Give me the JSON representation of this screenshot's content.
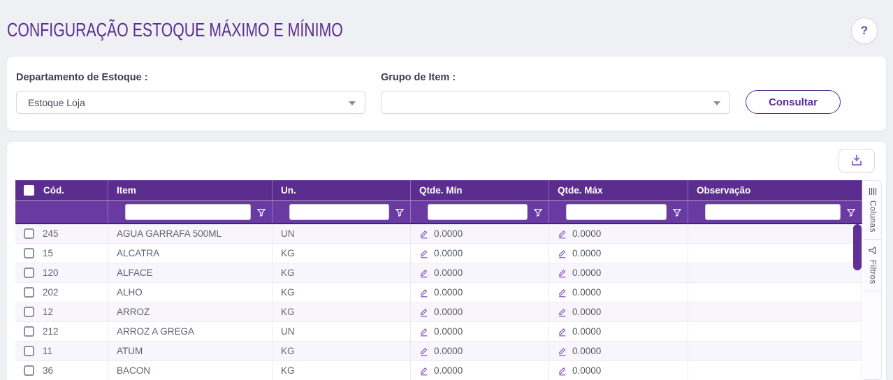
{
  "page": {
    "title": "CONFIGURAÇÃO ESTOQUE MÁXIMO E MÍNIMO",
    "help_label": "?"
  },
  "filters": {
    "department_label": "Departamento de Estoque :",
    "department_value": "Estoque Loja",
    "group_label": "Grupo de Item :",
    "group_value": "",
    "consult_button": "Consultar"
  },
  "table": {
    "columns": [
      "Cód.",
      "Item",
      "Un.",
      "Qtde. Mín",
      "Qtde. Máx",
      "Observação"
    ],
    "filter_values": {
      "item": "",
      "un": "",
      "min": "",
      "max": "",
      "obs": ""
    },
    "rows": [
      {
        "code": "245",
        "item": "AGUA GARRAFA 500ML",
        "un": "UN",
        "min": "0.0000",
        "max": "0.0000",
        "obs": ""
      },
      {
        "code": "15",
        "item": "ALCATRA",
        "un": "KG",
        "min": "0.0000",
        "max": "0.0000",
        "obs": ""
      },
      {
        "code": "120",
        "item": "ALFACE",
        "un": "KG",
        "min": "0.0000",
        "max": "0.0000",
        "obs": ""
      },
      {
        "code": "202",
        "item": "ALHO",
        "un": "KG",
        "min": "0.0000",
        "max": "0.0000",
        "obs": ""
      },
      {
        "code": "12",
        "item": "ARROZ",
        "un": "KG",
        "min": "0.0000",
        "max": "0.0000",
        "obs": ""
      },
      {
        "code": "212",
        "item": "ARROZ A GREGA",
        "un": "UN",
        "min": "0.0000",
        "max": "0.0000",
        "obs": ""
      },
      {
        "code": "11",
        "item": "ATUM",
        "un": "KG",
        "min": "0.0000",
        "max": "0.0000",
        "obs": ""
      },
      {
        "code": "36",
        "item": "BACON",
        "un": "KG",
        "min": "0.0000",
        "max": "0.0000",
        "obs": ""
      }
    ]
  },
  "side_tabs": [
    {
      "label": "Colunas"
    },
    {
      "label": "Filtros"
    }
  ],
  "colors": {
    "accent": "#5c2d91",
    "header_purple": "#5b2d8e",
    "filter_row_purple": "#693aa1",
    "zebra": "#f8f6fc",
    "page_bg": "#eef0f4"
  }
}
